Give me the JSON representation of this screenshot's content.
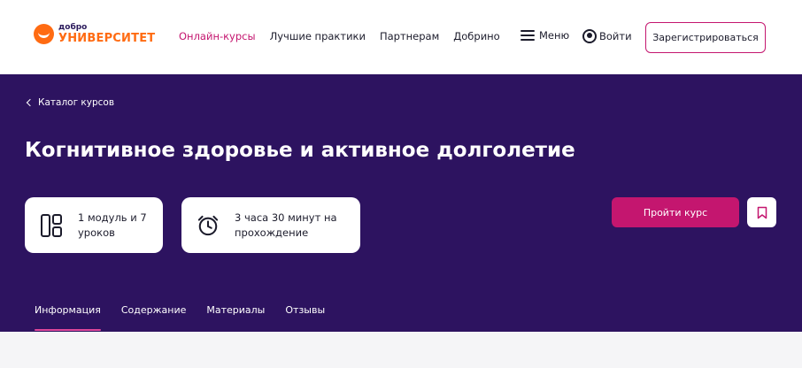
{
  "header": {
    "logo_small": "добро",
    "logo_big": "УНИВЕРСИТЕТ",
    "nav": [
      {
        "label": "Онлайн-курсы",
        "active": true
      },
      {
        "label": "Лучшие практики",
        "active": false
      },
      {
        "label": "Партнерам",
        "active": false
      },
      {
        "label": "Добрино",
        "active": false
      }
    ],
    "menu_label": "Меню",
    "login_label": "Войти",
    "register_label": "Зарегистрироваться"
  },
  "hero": {
    "back_label": "Каталог курсов",
    "title": "Когнитивное здоровье и активное долголетие",
    "cards": [
      {
        "icon": "modules-icon",
        "text_line1": "1 модуль и 7",
        "text_line2": "уроков"
      },
      {
        "icon": "alarm-clock-icon",
        "text_line1": "3 часа 30 минут на",
        "text_line2": "прохождение"
      }
    ],
    "take_course_label": "Пройти курс",
    "bookmark_icon": "bookmark-icon"
  },
  "tabs": [
    {
      "label": "Информация",
      "active": true
    },
    {
      "label": "Содержание",
      "active": false
    },
    {
      "label": "Материалы",
      "active": false
    },
    {
      "label": "Отзывы",
      "active": false
    }
  ],
  "colors": {
    "accent": "#c4166f",
    "brand_orange": "#ff6b12",
    "hero_bg": "#2d1360"
  }
}
